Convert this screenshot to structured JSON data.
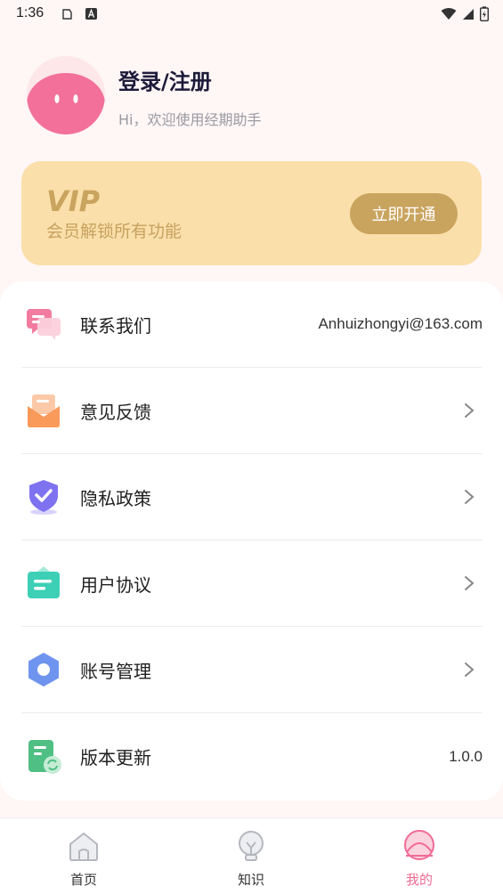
{
  "status_bar": {
    "time": "1:36"
  },
  "profile": {
    "login_label": "登录/注册",
    "welcome_text": "Hi，欢迎使用经期助手"
  },
  "vip": {
    "logo_text": "VIP",
    "description": "会员解锁所有功能",
    "button_label": "立即开通",
    "colors": {
      "card": "#fbdfaa",
      "button": "#c9a45f",
      "text": "#c6a25f"
    }
  },
  "menu": {
    "items": [
      {
        "label": "联系我们",
        "value": "Anhuizhongyi@163.com",
        "icon": "chat-icon"
      },
      {
        "label": "意见反馈",
        "icon": "mail-icon"
      },
      {
        "label": "隐私政策",
        "icon": "shield-icon"
      },
      {
        "label": "用户协议",
        "icon": "document-icon"
      },
      {
        "label": "账号管理",
        "icon": "account-hex-icon"
      },
      {
        "label": "版本更新",
        "value": "1.0.0",
        "icon": "update-icon"
      }
    ]
  },
  "bottom_nav": {
    "items": [
      {
        "label": "首页",
        "icon": "home-icon"
      },
      {
        "label": "知识",
        "icon": "lightbulb-icon"
      },
      {
        "label": "我的",
        "icon": "profile-icon",
        "active": true
      }
    ],
    "active_color": "#f06b95"
  }
}
